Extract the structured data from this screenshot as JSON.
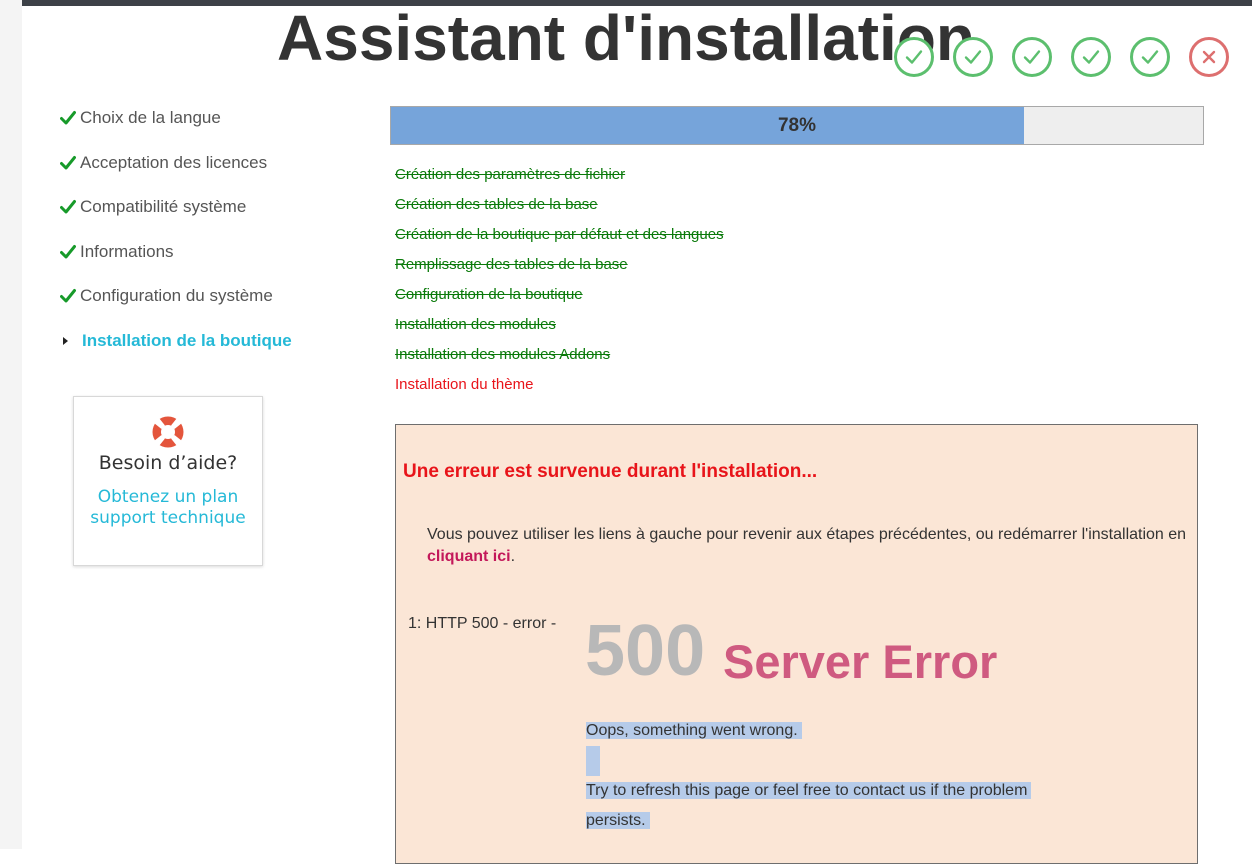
{
  "page": {
    "title": "Assistant d'installation"
  },
  "status_icons": [
    {
      "name": "check-circle-icon",
      "state": "done"
    },
    {
      "name": "check-circle-icon",
      "state": "done"
    },
    {
      "name": "check-circle-icon",
      "state": "done"
    },
    {
      "name": "check-circle-icon",
      "state": "done"
    },
    {
      "name": "check-circle-icon",
      "state": "done"
    },
    {
      "name": "cross-circle-icon",
      "state": "failed"
    }
  ],
  "sidebar": {
    "items": [
      {
        "label": "Choix de la langue",
        "status": "done"
      },
      {
        "label": "Acceptation des licences",
        "status": "done"
      },
      {
        "label": "Compatibilité système",
        "status": "done"
      },
      {
        "label": "Informations",
        "status": "done"
      },
      {
        "label": "Configuration du système",
        "status": "done"
      },
      {
        "label": "Installation de la boutique",
        "status": "active"
      }
    ]
  },
  "help": {
    "icon": "lifebuoy-icon",
    "title": "Besoin d’aide?",
    "link_line1": "Obtenez un plan",
    "link_line2": "support technique"
  },
  "progress": {
    "percent": 78,
    "label": "78%"
  },
  "tasks": [
    {
      "label": "Création des paramètres de fichier",
      "status": "done"
    },
    {
      "label": "Création des tables de la base",
      "status": "done"
    },
    {
      "label": "Création de la boutique par défaut et des langues",
      "status": "done"
    },
    {
      "label": "Remplissage des tables de la base",
      "status": "done"
    },
    {
      "label": "Configuration de la boutique",
      "status": "done"
    },
    {
      "label": "Installation des modules",
      "status": "done"
    },
    {
      "label": "Installation des modules Addons",
      "status": "done"
    },
    {
      "label": "Installation du thème",
      "status": "error"
    }
  ],
  "error": {
    "title": "Une erreur est survenue durant l'installation...",
    "message_before": "Vous pouvez utiliser les liens à gauche pour revenir aux étapes précédentes, ou redémarrer l'installation en ",
    "link": "cliquant ici",
    "message_after": ".",
    "ref": "1: HTTP 500 - error -",
    "code": "500",
    "code_text": "Server Error",
    "oops": "Oops, something went wrong.",
    "advice_line1": "Try to refresh this page or feel free to contact us if the problem",
    "advice_line2": "persists."
  },
  "colors": {
    "done": "#5cbf6e",
    "failed": "#dd6f6f",
    "accent": "#25b9d7",
    "task_done": "#0a7a0a",
    "task_error": "#e8141a",
    "progress_fill": "#76a4da"
  }
}
